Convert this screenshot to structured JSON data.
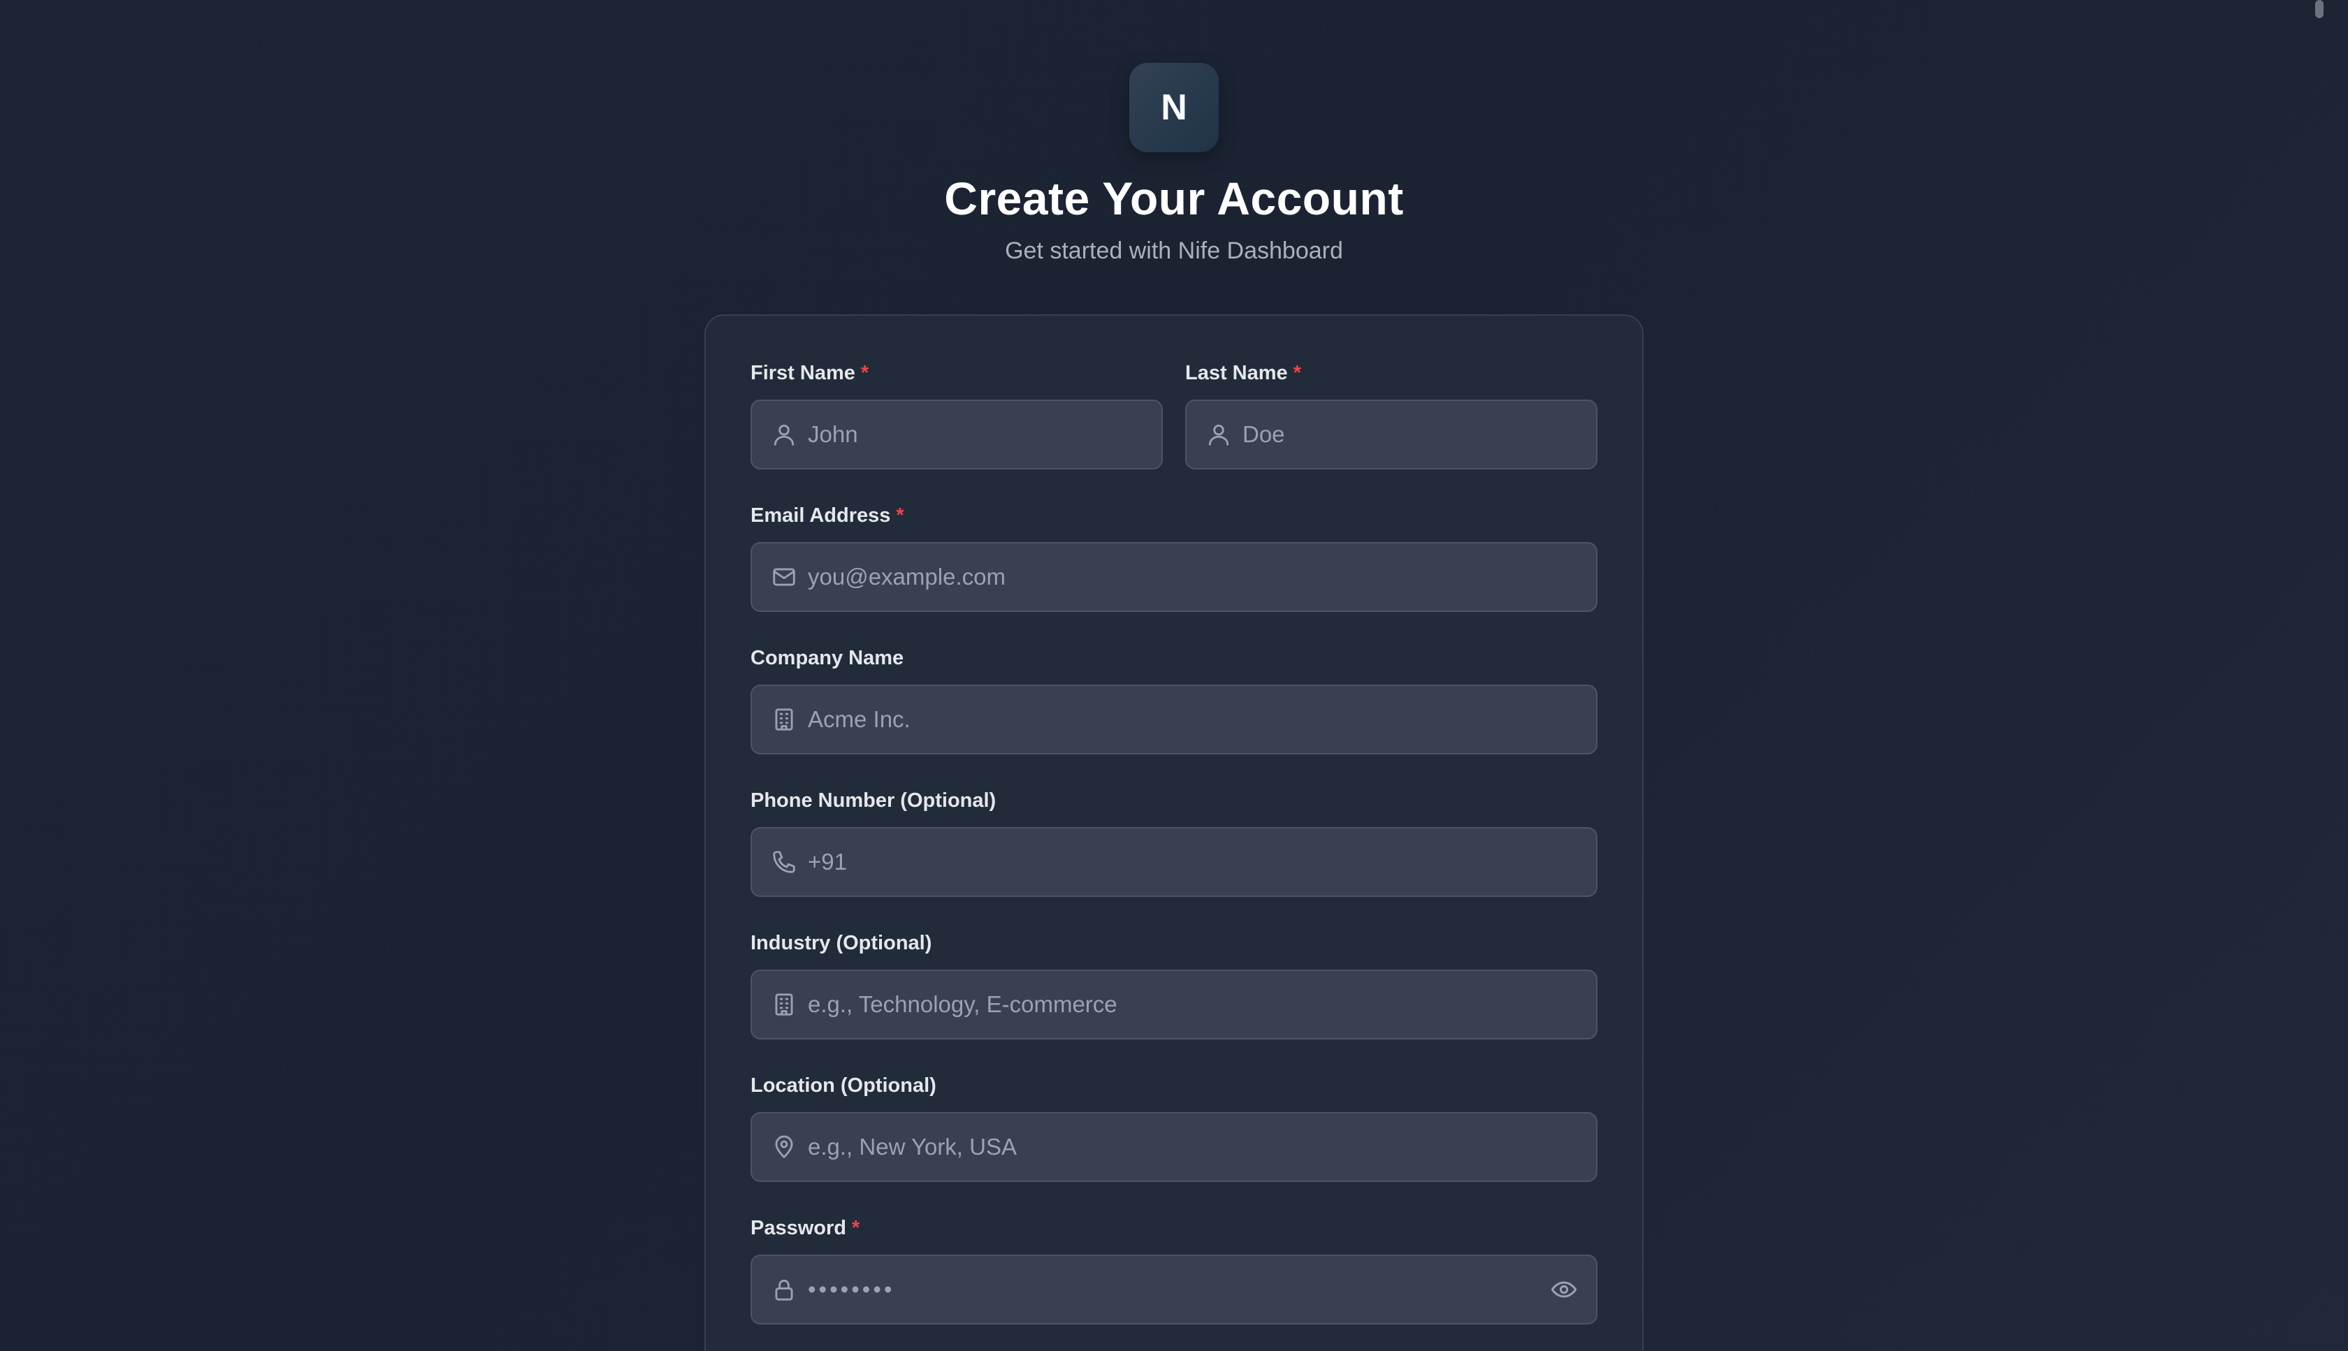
{
  "brand": {
    "logo_letter": "N"
  },
  "header": {
    "title": "Create Your Account",
    "subtitle": "Get started with Nife Dashboard"
  },
  "form": {
    "required_mark": "*",
    "first_name": {
      "label": "First Name",
      "placeholder": "John",
      "icon": "user-icon",
      "required": true
    },
    "last_name": {
      "label": "Last Name",
      "placeholder": "Doe",
      "icon": "user-icon",
      "required": true
    },
    "email": {
      "label": "Email Address",
      "placeholder": "you@example.com",
      "icon": "mail-icon",
      "required": true
    },
    "company": {
      "label": "Company Name",
      "placeholder": "Acme Inc.",
      "icon": "building-icon",
      "required": false
    },
    "phone": {
      "label": "Phone Number (Optional)",
      "placeholder": "+91",
      "icon": "phone-icon",
      "required": false
    },
    "industry": {
      "label": "Industry (Optional)",
      "placeholder": "e.g., Technology, E-commerce",
      "icon": "building-icon",
      "required": false
    },
    "location": {
      "label": "Location (Optional)",
      "placeholder": "e.g., New York, USA",
      "icon": "map-pin-icon",
      "required": false
    },
    "password": {
      "label": "Password",
      "placeholder": "••••••••",
      "icon": "lock-icon",
      "toggle_icon": "eye-icon",
      "required": true
    }
  },
  "colors": {
    "background": "#1c2534",
    "card": "#212b3a",
    "input": "#374151",
    "required": "#ef4444"
  }
}
